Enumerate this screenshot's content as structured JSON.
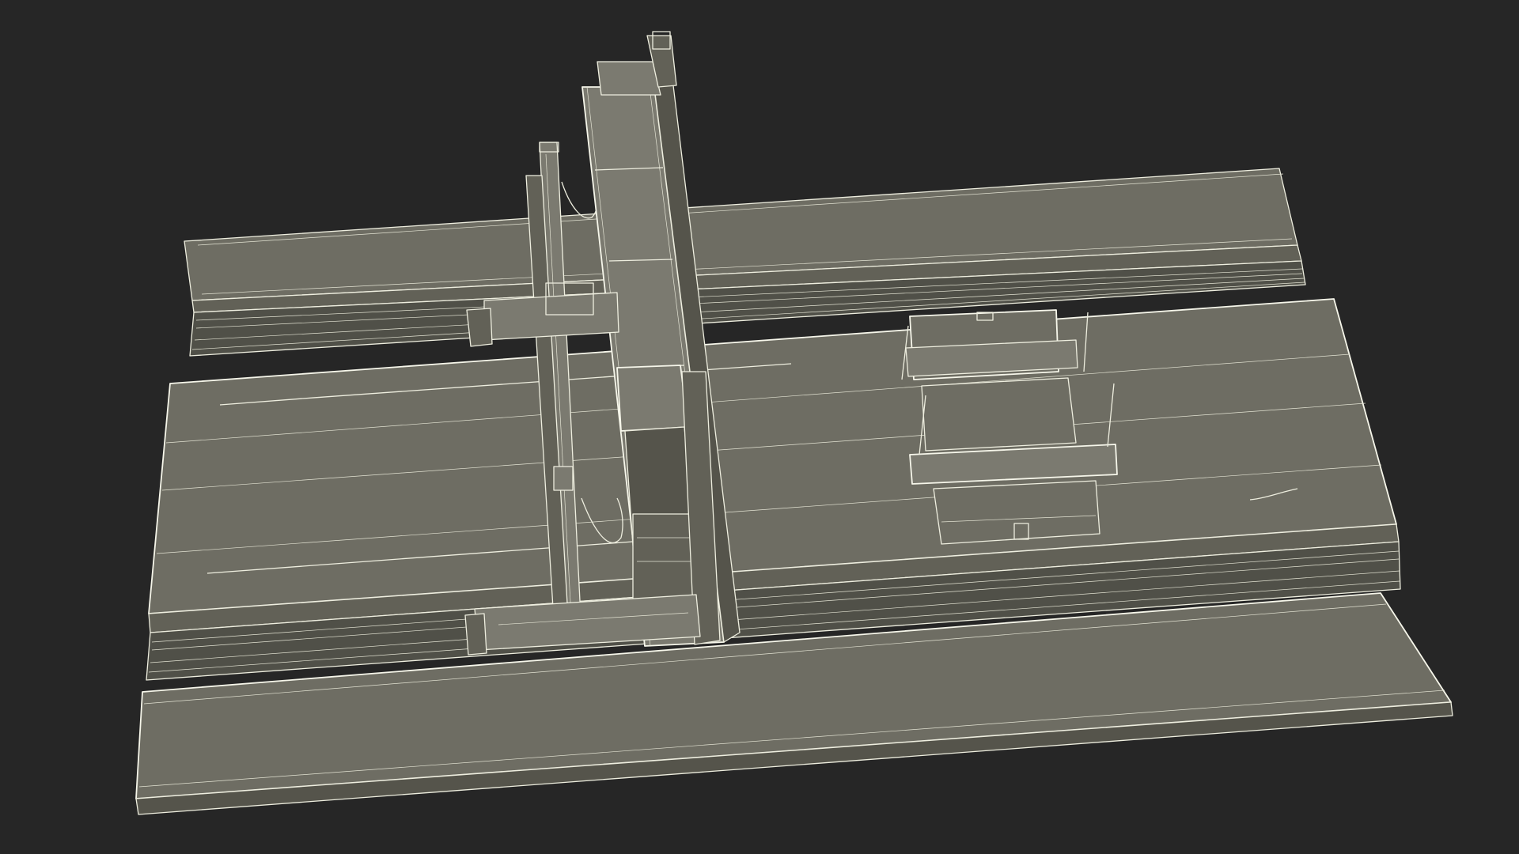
{
  "scene": {
    "background": "#262626",
    "wireframe_color": "#eeeedf",
    "surface_color": "#6e6d63",
    "render_mode": "wireframe-shaded",
    "subject": "gantry-machine-model"
  }
}
